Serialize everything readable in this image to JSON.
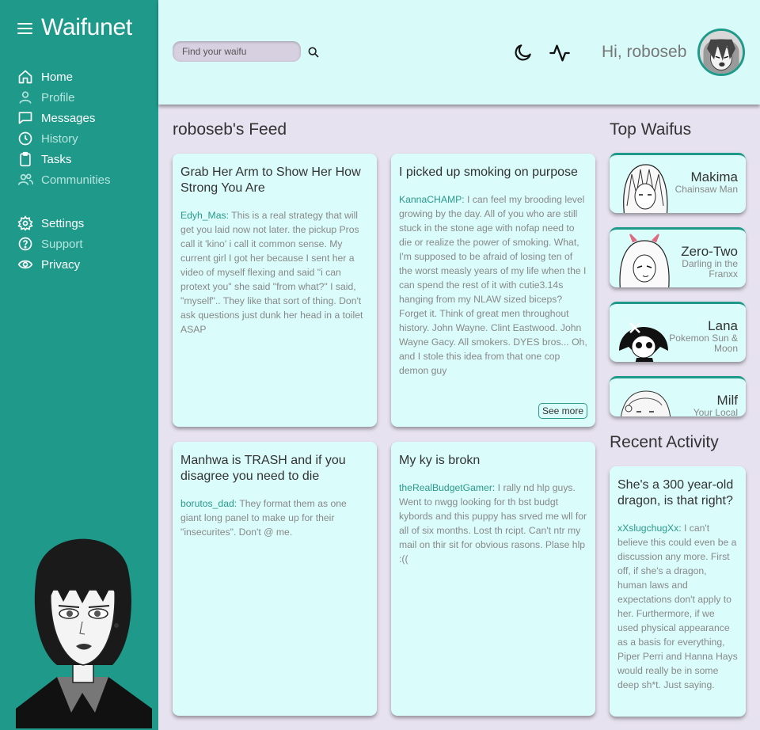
{
  "app": {
    "title": "Waifunet"
  },
  "nav": [
    {
      "label": "Home",
      "icon": "home-icon"
    },
    {
      "label": "Profile",
      "icon": "user-icon"
    },
    {
      "label": "Messages",
      "icon": "message-icon"
    },
    {
      "label": "History",
      "icon": "clock-icon"
    },
    {
      "label": "Tasks",
      "icon": "clipboard-icon"
    },
    {
      "label": "Communities",
      "icon": "users-icon"
    },
    {
      "label": "Settings",
      "icon": "gear-icon"
    },
    {
      "label": "Support",
      "icon": "help-icon"
    },
    {
      "label": "Privacy",
      "icon": "eye-icon"
    }
  ],
  "header": {
    "search_placeholder": "Find your waifu",
    "greeting": "Hi, roboseb"
  },
  "feed": {
    "title": "roboseb's Feed",
    "posts": [
      {
        "title": "Grab Her Arm to Show Her How Strong You Are",
        "author": "Edyh_Mas:",
        "body": " This is a real strategy that will get you laid now not later. the pickup Pros call it 'kino' i call it common sense. My current girl I got her because I sent her a video of myself flexing and said \"i can protext you\" she said \"from what?\" I said, \"myself\".. They like that sort of thing. Don't ask questions just dunk her head in a toilet ASAP"
      },
      {
        "title": "I picked up smoking on purpose",
        "author": "KannaCHAMP:",
        "body": " I can feel my brooding level growing by the day. All of you who are still stuck in the stone age with nofap need to die or realize the power of smoking. What, I'm supposed to be afraid of losing ten of the worst measly years of my life when the I can spend the rest of it with cutie3.14s hanging from my NLAW sized biceps? Forget it. Think of great men throughout history. John Wayne. Clint Eastwood. John Wayne Gacy. All smokers. DYES bros... Oh, and I stole this idea from that one cop demon guy",
        "see_more": "See more"
      },
      {
        "title": "Manhwa is TRASH and if you disagree you need to die",
        "author": "borutos_dad:",
        "body": " They format them as one giant long panel to make up for their \"insecurites\". Don't @ me."
      },
      {
        "title": "My ky is brokn",
        "author": "theRealBudgetGamer:",
        "body": " I rally nd hlp guys. Went to nwgg looking for th bst budgt kybords and this puppy has srved me wll for all of six months. Lost th rcipt. Can't ntr my mail on thir sit for obvious rasons. Plase hlp :(("
      }
    ]
  },
  "top_waifus": {
    "title": "Top Waifus",
    "items": [
      {
        "name": "Makima",
        "sub": "Chainsaw Man"
      },
      {
        "name": "Zero-Two",
        "sub": "Darling in the Franxx"
      },
      {
        "name": "Lana",
        "sub": "Pokemon Sun & Moon"
      },
      {
        "name": "Milf",
        "sub": "Your Local"
      }
    ]
  },
  "recent_activity": {
    "title": "Recent Activity",
    "post": {
      "title": "She's a 300 year-old dragon, is that right?",
      "author": "xXslugchugXx:",
      "body": " I can't believe this could even be a discussion any more. First off, if she's a dragon, human laws and expectations don't apply to her. Furthermore, if we used physical appearance as a basis for everything, Piper Perri and Hanna Hays would really be in some deep sh*t. Just saying."
    }
  },
  "colors": {
    "sidebar": "#1f9a8a",
    "accent": "#2a9a8a",
    "card": "#dafcfb",
    "background": "#e7e2f0",
    "header": "#d8fbfa"
  }
}
